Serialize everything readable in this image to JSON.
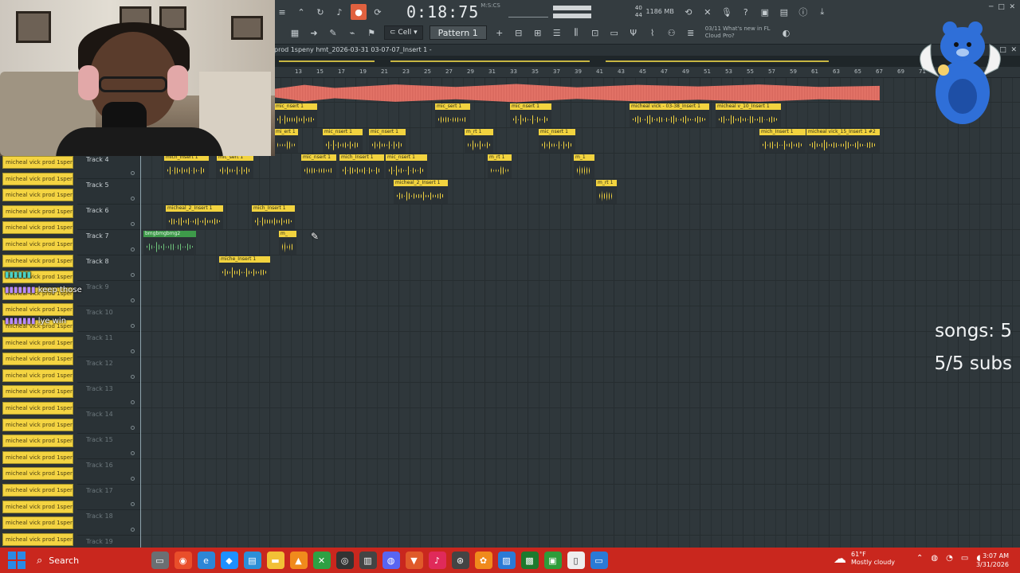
{
  "toolbar": {
    "time": "0:18:75",
    "time_sup": "M:S:CS",
    "cpu": [
      "40",
      "44"
    ],
    "mem": "1186 MB",
    "snap": "Cell",
    "pattern": "Pattern 1",
    "news_date": "03/11",
    "news_line1": "What's new in FL",
    "news_line2": "Cloud Pro?"
  },
  "playlist": {
    "title": "prod 1speny hmt_2026-03-31 03-07-07_Insert 1 -",
    "ruler": [
      "13",
      "15",
      "17",
      "19",
      "21",
      "23",
      "25",
      "27",
      "29",
      "31",
      "33",
      "35",
      "37",
      "39",
      "41",
      "43",
      "45",
      "47",
      "49",
      "51",
      "53",
      "55",
      "57",
      "59",
      "61",
      "63",
      "65",
      "67",
      "69",
      "71"
    ]
  },
  "tracks": [
    {
      "name": "Track 4"
    },
    {
      "name": "Track 5"
    },
    {
      "name": "Track 6"
    },
    {
      "name": "Track 7"
    },
    {
      "name": "Track 8"
    },
    {
      "name": "Track 9"
    },
    {
      "name": "Track 10"
    },
    {
      "name": "Track 11"
    },
    {
      "name": "Track 12"
    },
    {
      "name": "Track 13"
    },
    {
      "name": "Track 14"
    },
    {
      "name": "Track 15"
    },
    {
      "name": "Track 16"
    },
    {
      "name": "Track 17"
    },
    {
      "name": "Track 18"
    },
    {
      "name": "Track 19"
    }
  ],
  "clips": {
    "row1": [
      "mic_nsert 1",
      "mic_sert 1",
      "mic_nsert 1",
      "micheal vick - 03-38_Insert 1",
      "micheal v_10_Insert 1"
    ],
    "row2": [
      "mi_ert 1",
      "mic_nsert 1",
      "mic_nsert 1",
      "m_rt 1",
      "mic_nsert 1",
      "mich_Insert 1",
      "micheal vick_15_Insert 1 #2"
    ],
    "row3": [
      "mich_Insert 1",
      "mic_sert 1",
      "mic_nsert 1",
      "mich_Insert 1",
      "mic_nsert 1",
      "m_rt 1",
      "m_1"
    ],
    "row4": [
      "micheal_2_Insert 1",
      "m_rt 1"
    ],
    "row5": [
      "micheal_2_Insert 1",
      "mich_Insert 1"
    ],
    "row6": [
      "bmgbmgbmg2",
      "m_"
    ],
    "row7": [
      "miche_Insert 1"
    ]
  },
  "channels": [
    "micheal vick prod 1speny",
    "micheal vick prod 1speny",
    "micheal vick prod 1speny",
    "micheal vick prod 1speny",
    "micheal vick prod 1speny",
    "micheal vick prod 1speny",
    "micheal vick prod 1speny",
    "micheal vick prod 1speny",
    "micheal vick prod 1speny",
    "micheal vick prod 1speny",
    "micheal vick prod 1speny",
    "micheal vick prod 1speny",
    "micheal vick prod 1speny",
    "micheal vick prod 1speny",
    "micheal vick prod 1speny",
    "micheal vick prod 1speny",
    "micheal vick prod 1speny",
    "micheal vick prod 1speny",
    "micheal vick prod 1speny",
    "micheal vick prod 1speny",
    "micheal vick prod 1speny",
    "micheal vick prod 1speny",
    "micheal vick prod 1speny",
    "micheal vick prod 1speny"
  ],
  "chat": [
    {
      "user": "",
      "message": "keep those"
    },
    {
      "user": "",
      "message": "lye win"
    }
  ],
  "stats": {
    "songs": "songs: 5",
    "subs": "5/5 subs"
  },
  "taskbar": {
    "search": "Search",
    "weather_temp": "61°F",
    "weather_desc": "Mostly cloudy",
    "time": "3:07 AM",
    "date": "3/31/2026"
  }
}
